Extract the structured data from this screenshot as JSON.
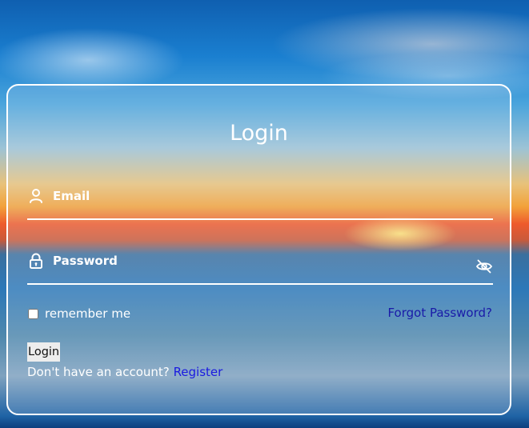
{
  "form": {
    "title": "Login",
    "email": {
      "label": "Email",
      "icon": "user-icon"
    },
    "password": {
      "label": "Password",
      "icon": "lock-icon",
      "toggle_icon": "eye-off-icon"
    },
    "remember_label": "remember me",
    "remember_checked": false,
    "forgot_label": "Forgot Password?",
    "login_label": "Login",
    "signup_prompt": "Don't have an account?",
    "register_label": "Register"
  },
  "colors": {
    "panel_border": "#ffffff",
    "text": "#ffffff",
    "link_forgot": "#1a1aa8",
    "link_register": "#1a1ae0"
  }
}
